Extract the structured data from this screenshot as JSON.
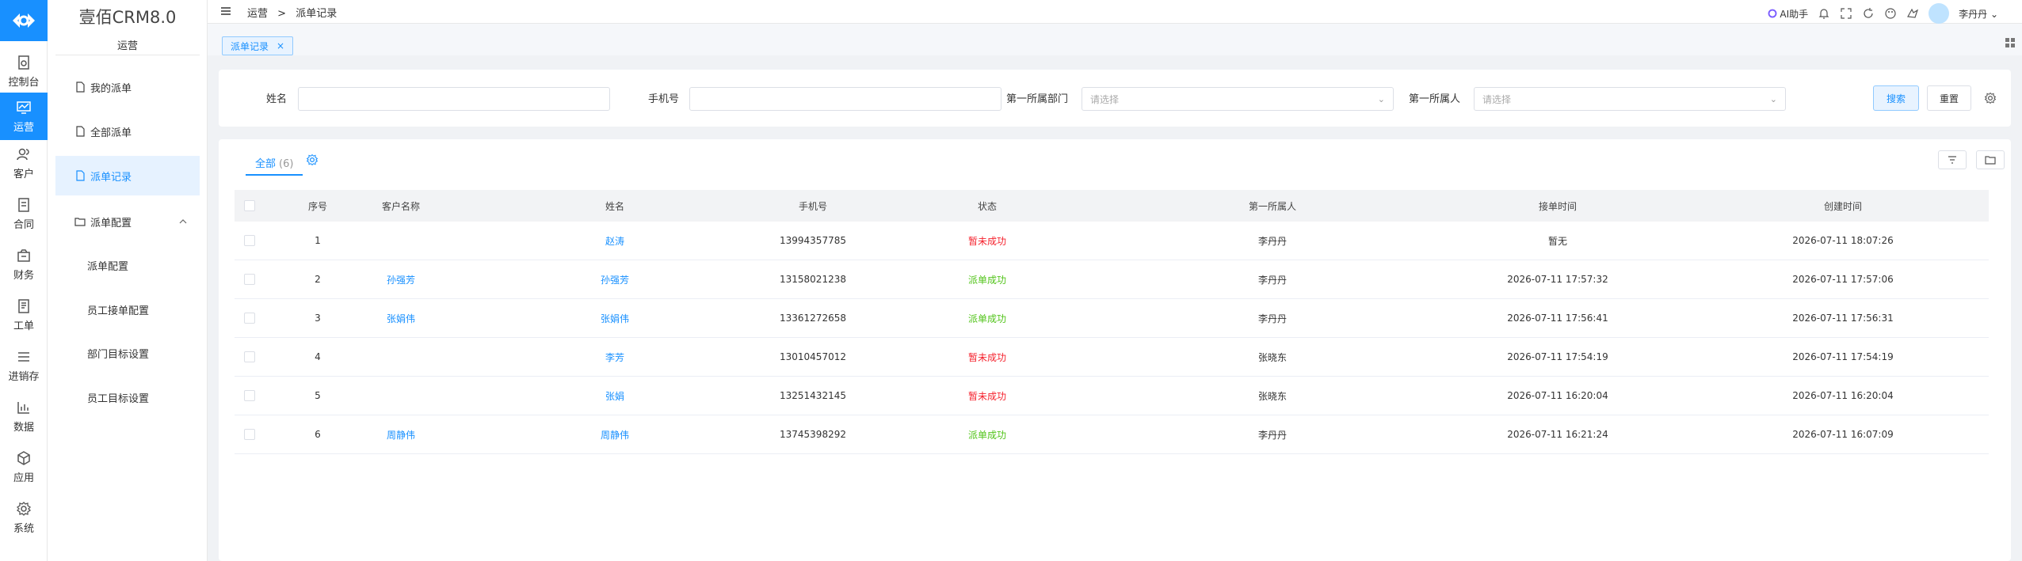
{
  "rail": {
    "items": [
      {
        "label": "控制台",
        "icon": "dashboard-icon"
      },
      {
        "label": "运营",
        "icon": "monitor-chart-icon"
      },
      {
        "label": "客户",
        "icon": "users-icon"
      },
      {
        "label": "合同",
        "icon": "contract-icon"
      },
      {
        "label": "财务",
        "icon": "wallet-icon"
      },
      {
        "label": "工单",
        "icon": "ticket-icon"
      },
      {
        "label": "进销存",
        "icon": "list-icon"
      },
      {
        "label": "数据",
        "icon": "bar-chart-icon"
      },
      {
        "label": "应用",
        "icon": "cube-icon"
      },
      {
        "label": "系统",
        "icon": "gear-icon"
      }
    ]
  },
  "sub": {
    "brand": "壹佰CRM8.0",
    "section": "运营",
    "items": [
      {
        "label": "我的派单"
      },
      {
        "label": "全部派单"
      },
      {
        "label": "派单记录"
      },
      {
        "label": "派单配置"
      }
    ],
    "children": [
      {
        "label": "派单配置"
      },
      {
        "label": "员工接单配置"
      },
      {
        "label": "部门目标设置"
      },
      {
        "label": "员工目标设置"
      }
    ]
  },
  "top": {
    "crumb1": "运营",
    "sep": ">",
    "crumb2": "派单记录",
    "ai": "AI助手",
    "user": "李丹丹"
  },
  "tabs": {
    "active": "派单记录",
    "close": "×"
  },
  "filters": {
    "name_label": "姓名",
    "phone_label": "手机号",
    "dept_label": "第一所属部门",
    "dept_placeholder": "请选择",
    "owner_label": "第一所属人",
    "owner_placeholder": "请选择",
    "search_btn": "搜索",
    "reset_btn": "重置"
  },
  "table": {
    "tab_label": "全部",
    "tab_count": "(6)",
    "headers": [
      "序号",
      "客户名称",
      "姓名",
      "手机号",
      "状态",
      "第一所属人",
      "接单时间",
      "创建时间"
    ],
    "rows": [
      {
        "no": "1",
        "customer": "",
        "name": "赵涛",
        "phone": "13994357785",
        "status": "暂未成功",
        "owner": "李丹丹",
        "accept": "暂无",
        "created": "2026-07-11 18:07:26",
        "ok": false
      },
      {
        "no": "2",
        "customer": "孙强芳",
        "name": "孙强芳",
        "phone": "13158021238",
        "status": "派单成功",
        "owner": "李丹丹",
        "accept": "2026-07-11 17:57:32",
        "created": "2026-07-11 17:57:06",
        "ok": true
      },
      {
        "no": "3",
        "customer": "张娟伟",
        "name": "张娟伟",
        "phone": "13361272658",
        "status": "派单成功",
        "owner": "李丹丹",
        "accept": "2026-07-11 17:56:41",
        "created": "2026-07-11 17:56:31",
        "ok": true
      },
      {
        "no": "4",
        "customer": "",
        "name": "李芳",
        "phone": "13010457012",
        "status": "暂未成功",
        "owner": "张晓东",
        "accept": "2026-07-11 17:54:19",
        "created": "2026-07-11 17:54:19",
        "ok": false
      },
      {
        "no": "5",
        "customer": "",
        "name": "张娟",
        "phone": "13251432145",
        "status": "暂未成功",
        "owner": "张晓东",
        "accept": "2026-07-11 16:20:04",
        "created": "2026-07-11 16:20:04",
        "ok": false
      },
      {
        "no": "6",
        "customer": "周静伟",
        "name": "周静伟",
        "phone": "13745398292",
        "status": "派单成功",
        "owner": "李丹丹",
        "accept": "2026-07-11 16:21:24",
        "created": "2026-07-11 16:07:09",
        "ok": true
      }
    ]
  },
  "colors": {
    "accent": "#1890ff",
    "fail": "#f5222d",
    "ok": "#52c41a"
  }
}
